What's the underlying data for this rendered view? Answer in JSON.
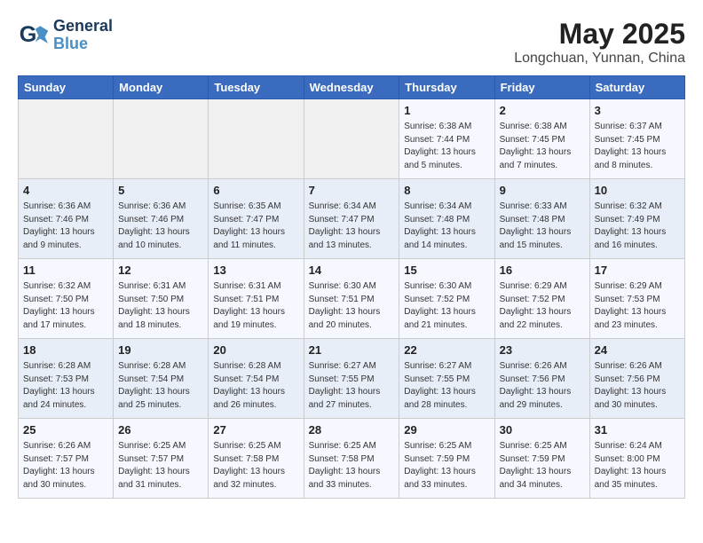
{
  "header": {
    "logo_line1": "General",
    "logo_line2": "Blue",
    "month_title": "May 2025",
    "location": "Longchuan, Yunnan, China"
  },
  "days_of_week": [
    "Sunday",
    "Monday",
    "Tuesday",
    "Wednesday",
    "Thursday",
    "Friday",
    "Saturday"
  ],
  "weeks": [
    [
      {
        "num": "",
        "info": ""
      },
      {
        "num": "",
        "info": ""
      },
      {
        "num": "",
        "info": ""
      },
      {
        "num": "",
        "info": ""
      },
      {
        "num": "1",
        "info": "Sunrise: 6:38 AM\nSunset: 7:44 PM\nDaylight: 13 hours\nand 5 minutes."
      },
      {
        "num": "2",
        "info": "Sunrise: 6:38 AM\nSunset: 7:45 PM\nDaylight: 13 hours\nand 7 minutes."
      },
      {
        "num": "3",
        "info": "Sunrise: 6:37 AM\nSunset: 7:45 PM\nDaylight: 13 hours\nand 8 minutes."
      }
    ],
    [
      {
        "num": "4",
        "info": "Sunrise: 6:36 AM\nSunset: 7:46 PM\nDaylight: 13 hours\nand 9 minutes."
      },
      {
        "num": "5",
        "info": "Sunrise: 6:36 AM\nSunset: 7:46 PM\nDaylight: 13 hours\nand 10 minutes."
      },
      {
        "num": "6",
        "info": "Sunrise: 6:35 AM\nSunset: 7:47 PM\nDaylight: 13 hours\nand 11 minutes."
      },
      {
        "num": "7",
        "info": "Sunrise: 6:34 AM\nSunset: 7:47 PM\nDaylight: 13 hours\nand 13 minutes."
      },
      {
        "num": "8",
        "info": "Sunrise: 6:34 AM\nSunset: 7:48 PM\nDaylight: 13 hours\nand 14 minutes."
      },
      {
        "num": "9",
        "info": "Sunrise: 6:33 AM\nSunset: 7:48 PM\nDaylight: 13 hours\nand 15 minutes."
      },
      {
        "num": "10",
        "info": "Sunrise: 6:32 AM\nSunset: 7:49 PM\nDaylight: 13 hours\nand 16 minutes."
      }
    ],
    [
      {
        "num": "11",
        "info": "Sunrise: 6:32 AM\nSunset: 7:50 PM\nDaylight: 13 hours\nand 17 minutes."
      },
      {
        "num": "12",
        "info": "Sunrise: 6:31 AM\nSunset: 7:50 PM\nDaylight: 13 hours\nand 18 minutes."
      },
      {
        "num": "13",
        "info": "Sunrise: 6:31 AM\nSunset: 7:51 PM\nDaylight: 13 hours\nand 19 minutes."
      },
      {
        "num": "14",
        "info": "Sunrise: 6:30 AM\nSunset: 7:51 PM\nDaylight: 13 hours\nand 20 minutes."
      },
      {
        "num": "15",
        "info": "Sunrise: 6:30 AM\nSunset: 7:52 PM\nDaylight: 13 hours\nand 21 minutes."
      },
      {
        "num": "16",
        "info": "Sunrise: 6:29 AM\nSunset: 7:52 PM\nDaylight: 13 hours\nand 22 minutes."
      },
      {
        "num": "17",
        "info": "Sunrise: 6:29 AM\nSunset: 7:53 PM\nDaylight: 13 hours\nand 23 minutes."
      }
    ],
    [
      {
        "num": "18",
        "info": "Sunrise: 6:28 AM\nSunset: 7:53 PM\nDaylight: 13 hours\nand 24 minutes."
      },
      {
        "num": "19",
        "info": "Sunrise: 6:28 AM\nSunset: 7:54 PM\nDaylight: 13 hours\nand 25 minutes."
      },
      {
        "num": "20",
        "info": "Sunrise: 6:28 AM\nSunset: 7:54 PM\nDaylight: 13 hours\nand 26 minutes."
      },
      {
        "num": "21",
        "info": "Sunrise: 6:27 AM\nSunset: 7:55 PM\nDaylight: 13 hours\nand 27 minutes."
      },
      {
        "num": "22",
        "info": "Sunrise: 6:27 AM\nSunset: 7:55 PM\nDaylight: 13 hours\nand 28 minutes."
      },
      {
        "num": "23",
        "info": "Sunrise: 6:26 AM\nSunset: 7:56 PM\nDaylight: 13 hours\nand 29 minutes."
      },
      {
        "num": "24",
        "info": "Sunrise: 6:26 AM\nSunset: 7:56 PM\nDaylight: 13 hours\nand 30 minutes."
      }
    ],
    [
      {
        "num": "25",
        "info": "Sunrise: 6:26 AM\nSunset: 7:57 PM\nDaylight: 13 hours\nand 30 minutes."
      },
      {
        "num": "26",
        "info": "Sunrise: 6:25 AM\nSunset: 7:57 PM\nDaylight: 13 hours\nand 31 minutes."
      },
      {
        "num": "27",
        "info": "Sunrise: 6:25 AM\nSunset: 7:58 PM\nDaylight: 13 hours\nand 32 minutes."
      },
      {
        "num": "28",
        "info": "Sunrise: 6:25 AM\nSunset: 7:58 PM\nDaylight: 13 hours\nand 33 minutes."
      },
      {
        "num": "29",
        "info": "Sunrise: 6:25 AM\nSunset: 7:59 PM\nDaylight: 13 hours\nand 33 minutes."
      },
      {
        "num": "30",
        "info": "Sunrise: 6:25 AM\nSunset: 7:59 PM\nDaylight: 13 hours\nand 34 minutes."
      },
      {
        "num": "31",
        "info": "Sunrise: 6:24 AM\nSunset: 8:00 PM\nDaylight: 13 hours\nand 35 minutes."
      }
    ]
  ]
}
